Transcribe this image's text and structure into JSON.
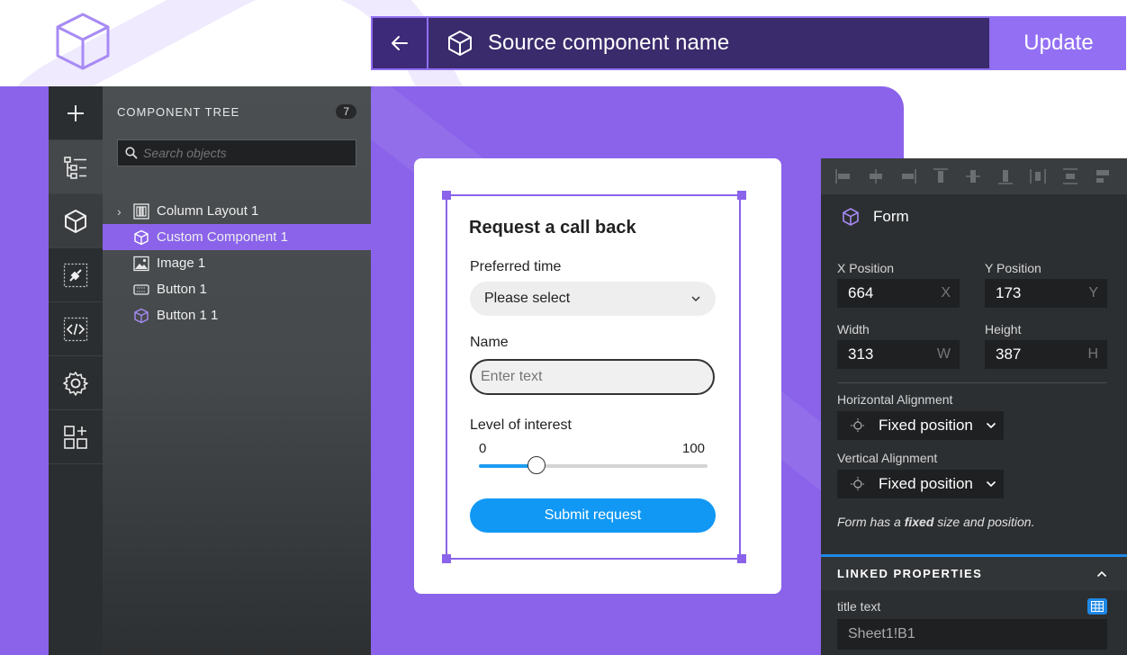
{
  "topbar": {
    "component_name": "Source component name",
    "update_label": "Update"
  },
  "sidebar": {
    "rail_icons": [
      "plus-icon",
      "tree-icon",
      "cube-icon",
      "plugin-icon",
      "code-icon",
      "gear-icon",
      "add-widget-icon"
    ]
  },
  "tree": {
    "title": "COMPONENT TREE",
    "count": "7",
    "search_placeholder": "Search objects",
    "items": [
      {
        "label": "Column Layout 1",
        "icon": "columns-icon"
      },
      {
        "label": "Custom Component 1",
        "icon": "cube-icon"
      },
      {
        "label": "Image 1",
        "icon": "image-icon"
      },
      {
        "label": "Button 1",
        "icon": "button-icon"
      },
      {
        "label": "Button 1 1",
        "icon": "cube-icon"
      }
    ]
  },
  "form": {
    "title": "Request a call back",
    "time_label": "Preferred time",
    "time_value": "Please select",
    "name_label": "Name",
    "name_placeholder": "Enter text",
    "interest_label": "Level of interest",
    "range_min": "0",
    "range_max": "100",
    "slider_fraction": 0.25,
    "submit_label": "Submit request"
  },
  "props": {
    "header": "Form",
    "x_label": "X Position",
    "x_value": "664",
    "x_unit": "X",
    "y_label": "Y Position",
    "y_value": "173",
    "y_unit": "Y",
    "w_label": "Width",
    "w_value": "313",
    "w_unit": "W",
    "h_label": "Height",
    "h_value": "387",
    "h_unit": "H",
    "halign_label": "Horizontal Alignment",
    "halign_value": "Fixed position",
    "valign_label": "Vertical Alignment",
    "valign_value": "Fixed position",
    "note_prefix": "Form has a ",
    "note_bold": "fixed",
    "note_suffix": " size and position.",
    "linked_title": "LINKED PROPERTIES",
    "title_text_label": "title text",
    "title_text_value": "Sheet1!B1"
  },
  "colors": {
    "accent": "#8a63ea",
    "primary_button": "#1198f4",
    "panel_dark": "#2c2f31"
  }
}
